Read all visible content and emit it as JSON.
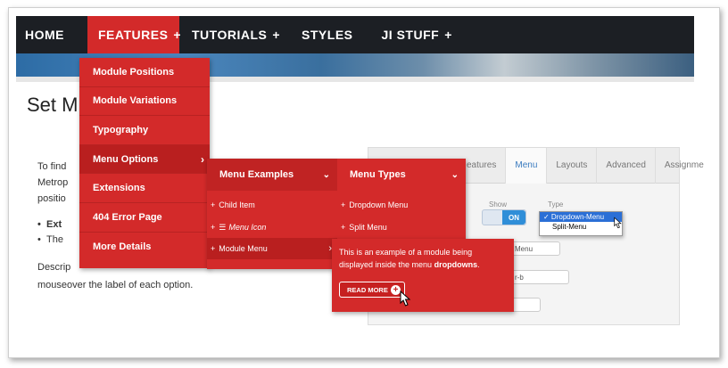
{
  "nav": {
    "items": [
      {
        "label": "HOME",
        "plus": ""
      },
      {
        "label": "FEATURES",
        "plus": "+"
      },
      {
        "label": "TUTORIALS",
        "plus": "+"
      },
      {
        "label": "STYLES",
        "plus": ""
      },
      {
        "label": "JI STUFF",
        "plus": "+"
      }
    ]
  },
  "page": {
    "title": "Set M",
    "para1_line1": "To find",
    "para1_line2": "Metrop",
    "para1_line3": "positio",
    "bullet1": "Ext",
    "bullet2": "The",
    "para2_line1": "Descrip",
    "para2_line2": "mouseover the label of each option."
  },
  "admin": {
    "tabs": [
      "eatures",
      "Menu",
      "Layouts",
      "Advanced",
      "Assignme"
    ],
    "show_label": "Show",
    "type_label": "Type",
    "toggle_on": "ON",
    "type_options": [
      "✓ Dropdown-Menu",
      "Split-Menu"
    ],
    "select1": "Menu",
    "select2": "r-b"
  },
  "menu1": {
    "items": [
      {
        "label": "Module Positions"
      },
      {
        "label": "Module Variations"
      },
      {
        "label": "Typography"
      },
      {
        "label": "Menu Options",
        "chevron": "›"
      },
      {
        "label": "Extensions"
      },
      {
        "label": "404 Error Page"
      },
      {
        "label": "More Details"
      }
    ]
  },
  "menu2": {
    "left_header": "Menu Examples",
    "right_header": "Menu Types",
    "chevron_down": "⌄",
    "left_items": [
      {
        "label": "Child Item",
        "icon": ""
      },
      {
        "label": "Menu Icon",
        "icon": "☰"
      },
      {
        "label": "Module Menu",
        "chevron": "›"
      }
    ],
    "right_items": [
      {
        "label": "Dropdown Menu"
      },
      {
        "label": "Split Menu"
      }
    ]
  },
  "popup": {
    "text_a": "This is an example of a module being",
    "text_b": "displayed inside the menu ",
    "text_bold": "dropdowns",
    "text_end": ".",
    "button": "READ MORE"
  }
}
